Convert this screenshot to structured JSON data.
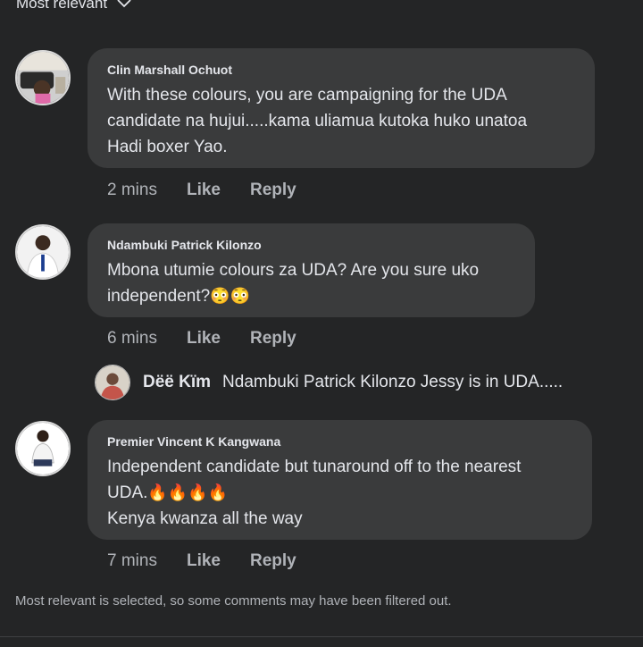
{
  "sort": {
    "label": "Most relevant"
  },
  "comments": [
    {
      "author": "Clin Marshall Ochuot",
      "lines": [
        "With these colours, you are campaigning for the UDA",
        "candidate na hujui.....kama uliamua kutoka huko unatoa",
        "Hadi boxer Yao."
      ],
      "time": "2 mins",
      "like": "Like",
      "reply": "Reply"
    },
    {
      "author": "Ndambuki Patrick Kilonzo",
      "lines": [
        "Mbona utumie colours za UDA? Are you sure uko",
        "independent?"
      ],
      "emoji": "😳😳",
      "time": "6 mins",
      "like": "Like",
      "reply": "Reply"
    },
    {
      "author": "Premier Vincent K Kangwana",
      "lines": [
        "Independent candidate but tunaround off to the nearest",
        "UDA.",
        "Kenya kwanza all the way"
      ],
      "emoji": "🔥🔥🔥🔥",
      "time": "7 mins",
      "like": "Like",
      "reply": "Reply"
    }
  ],
  "reply_preview": {
    "author": "Dëë Kïm",
    "text": "Ndambuki Patrick Kilonzo Jessy is in UDA....."
  },
  "footer": {
    "note": "Most relevant is selected, so some comments may have been filtered out."
  },
  "colors": {
    "background": "#242526",
    "bubble": "#3a3b3c",
    "text": "#e4e6eb",
    "muted": "#b0b3b8"
  }
}
